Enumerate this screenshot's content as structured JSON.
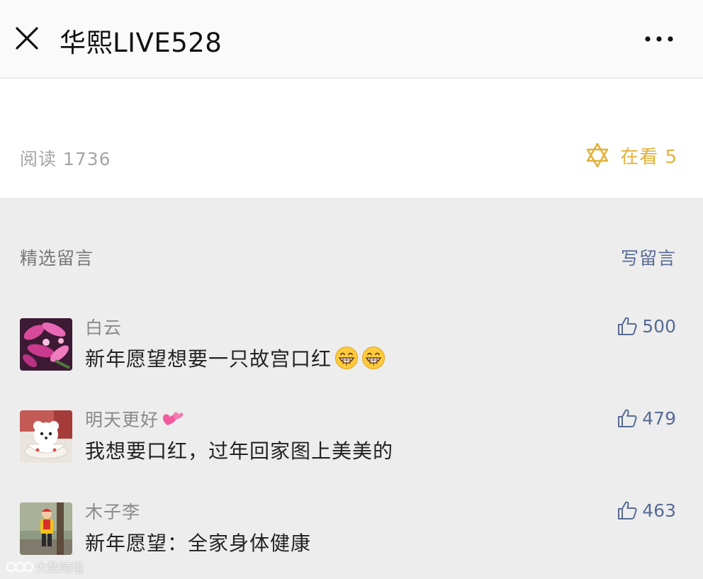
{
  "header": {
    "title": "华熙LIVE528",
    "close_icon": "close-icon",
    "more_icon": "more-dots-icon"
  },
  "stats": {
    "reads_label": "阅读 1736",
    "looking_label": "在看 5",
    "looking_icon": "hexagram-star-icon",
    "accent_color": "#e2b13a"
  },
  "comments_section": {
    "title": "精选留言",
    "write_label": "写留言",
    "link_color": "#576b95",
    "items": [
      {
        "nickname": "白云",
        "content": "新年愿望想要一只故宫口红",
        "likes": "500",
        "content_emoji": [
          "grin-emoji",
          "grin-emoji"
        ]
      },
      {
        "nickname": "明天更好",
        "nickname_emoji": "two-hearts-emoji",
        "content": "我想要口红，过年回家图上美美的",
        "likes": "479"
      },
      {
        "nickname": "木子李",
        "content": "新年愿望：全家身体健康",
        "likes": "463"
      }
    ]
  },
  "watermark": {
    "text": "大数跨境"
  }
}
